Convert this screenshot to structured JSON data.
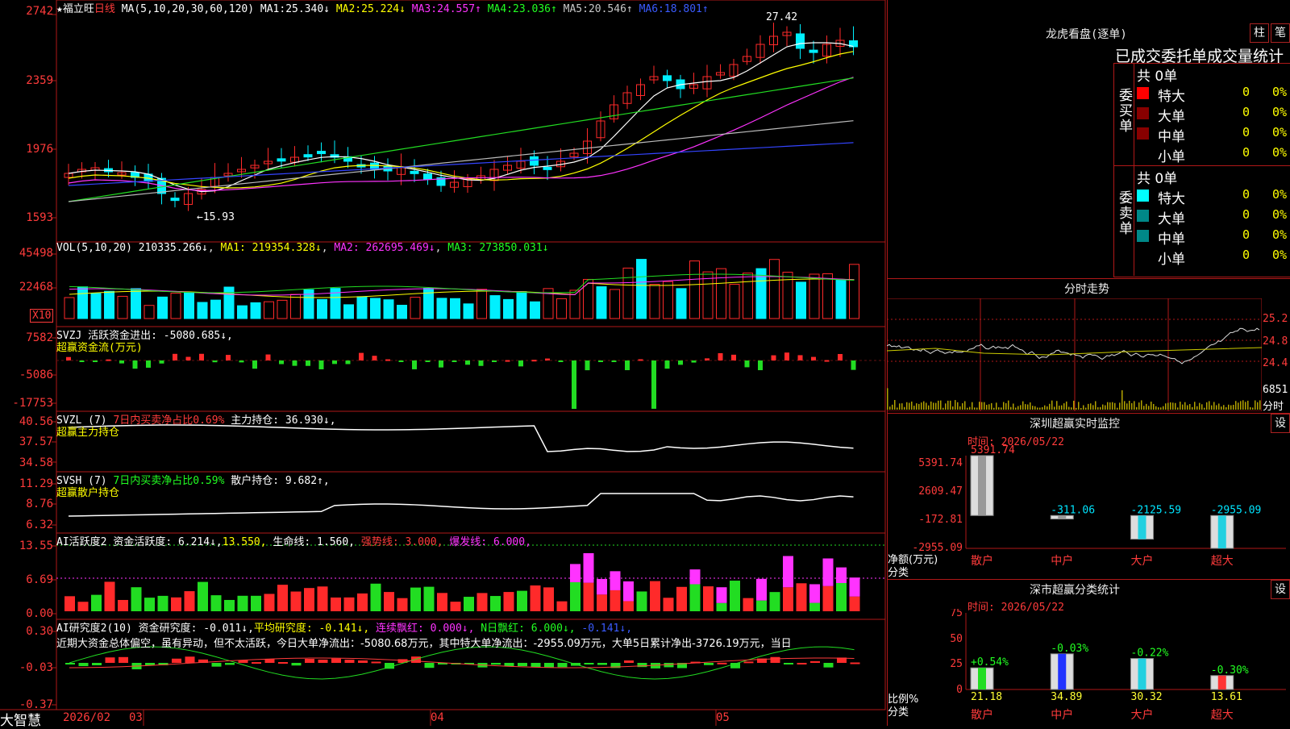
{
  "colors": {
    "up": "#ff2a2a",
    "down": "#00f0ff",
    "ma1": "#ffffff",
    "ma2": "#ffff00",
    "ma3": "#ff33ff",
    "ma4": "#22dd22",
    "ma5": "#bbbbbb",
    "ma6": "#3344ff",
    "grid": "#b01818"
  },
  "header": {
    "stock_name": "福立旺",
    "period": "日线",
    "ma_label": "MA(5,10,20,30,60,120)",
    "ma": [
      {
        "label": "MA1:",
        "value": "25.340↓"
      },
      {
        "label": "MA2:",
        "value": "25.224↓"
      },
      {
        "label": "MA3:",
        "value": "24.557↑"
      },
      {
        "label": "MA4:",
        "value": "23.036↑"
      },
      {
        "label": "MA5:",
        "value": "20.546↑"
      },
      {
        "label": "MA6:",
        "value": "18.801↑"
      }
    ]
  },
  "axes": {
    "price": [
      "2742",
      "2359",
      "1976",
      "1593"
    ],
    "vol": [
      "45498",
      "22468",
      "X10"
    ],
    "svzj": [
      "7582",
      "-5086",
      "-17753"
    ],
    "svzl": [
      "40.56",
      "37.57",
      "34.58"
    ],
    "svsh": [
      "11.29",
      "8.76",
      "6.32"
    ],
    "ai1": [
      "13.55",
      "6.69",
      "0.00"
    ],
    "ai2": [
      "0.30",
      "-0.03",
      "-0.37"
    ]
  },
  "annotations": {
    "high": "27.42",
    "low": "←15.93"
  },
  "vol_header": {
    "label": "VOL(5,10,20)",
    "value": "210335.266↓",
    "ma1": "MA1: 219354.328↓",
    "ma2": "MA2: 262695.469↓",
    "ma3": "MA3: 273850.031↓"
  },
  "svzj_header": {
    "label": "SVZJ",
    "text": "活跃资金进出: -5080.685↓,",
    "sub": "超赢资金流(万元)"
  },
  "svzl_header": {
    "label": "SVZL (7)",
    "text1": "7日内买卖净占比0.69%",
    "text2": "主力持仓: 36.930↓,",
    "sub": "超赢主力持仓"
  },
  "svsh_header": {
    "label": "SVSH (7)",
    "text1": "7日内买卖净占比0.59%",
    "text2": "散户持仓: 9.682↑,",
    "sub": "超赢散户持仓"
  },
  "ai1_header": {
    "label": "AI活跃度2",
    "t1": "资金活跃度: 6.214↓,",
    "t2": "13.550,",
    "t3": "生命线: 1.560,",
    "t4": "强势线: 3.000,",
    "t5": "爆发线: 6.000,"
  },
  "ai2_header": {
    "label": "AI研究度2(10)",
    "t1": "资金研究度: -0.011↓,",
    "t2": "平均研究度: -0.141↓,",
    "t3": "连续飘红: 0.000↓,",
    "t4": "N日飘红: 6.000↓,",
    "t5": "-0.141↓,",
    "note": "近期大资金总体偏空，虽有异动，但不太活跃，今日大单净流出：-5080.68万元，其中特大单净流出：-2955.09万元，大单5日累计净出-3726.19万元，当日"
  },
  "footer": {
    "brand": "大智慧",
    "date": "2026/02",
    "m3": "03",
    "m4": "04",
    "m5": "05"
  },
  "sidebar": {
    "title": "龙虎看盘(逐单)",
    "btn1": "柱",
    "btn2": "笔",
    "subtitle": "已成交委托单成交量统计",
    "buy": {
      "label": "委买单",
      "total": "共 0单",
      "rows": [
        {
          "name": "特大",
          "v": "0",
          "p": "0%"
        },
        {
          "name": "大单",
          "v": "0",
          "p": "0%"
        },
        {
          "name": "中单",
          "v": "0",
          "p": "0%"
        },
        {
          "name": "小单",
          "v": "0",
          "p": "0%"
        }
      ]
    },
    "sell": {
      "label": "委卖单",
      "total": "共 0单",
      "rows": [
        {
          "name": "特大",
          "v": "0",
          "p": "0%"
        },
        {
          "name": "大单",
          "v": "0",
          "p": "0%"
        },
        {
          "name": "中单",
          "v": "0",
          "p": "0%"
        },
        {
          "name": "小单",
          "v": "0",
          "p": "0%"
        }
      ]
    },
    "intraday": {
      "title": "分时走势",
      "p1": "25.2",
      "p2": "24.8",
      "p3": "24.4",
      "vol": "6851",
      "unit": "分时"
    },
    "monitor": {
      "title": "深圳超赢实时监控",
      "btn": "设",
      "time": "时间: 2026/05/22",
      "axis": [
        "5391.74",
        "2609.47",
        "-172.81",
        "-2955.09"
      ],
      "ylabel1": "净额(万元)",
      "ylabel2": "分类"
    },
    "classify": {
      "title": "深市超赢分类统计",
      "btn": "设",
      "time": "时间: 2026/05/22",
      "axis": [
        "75",
        "50",
        "25",
        "0"
      ],
      "ylabel1": "比例%",
      "ylabel2": "分类"
    }
  },
  "chart_data": [
    {
      "type": "bar",
      "title": "深圳超赢实时监控",
      "categories": [
        "散户",
        "中户",
        "大户",
        "超大"
      ],
      "values": [
        5391.74,
        -311.06,
        -2125.59,
        -2955.09
      ],
      "ylim": [
        -2955.09,
        5391.74
      ]
    },
    {
      "type": "bar",
      "title": "深市超赢分类统计",
      "categories": [
        "散户",
        "中户",
        "大户",
        "超大"
      ],
      "values": [
        21.18,
        34.89,
        30.32,
        13.61
      ],
      "labels": [
        "+0.54%",
        "-0.03%",
        "-0.22%",
        "-0.30%"
      ],
      "ylim": [
        0,
        75
      ]
    }
  ]
}
